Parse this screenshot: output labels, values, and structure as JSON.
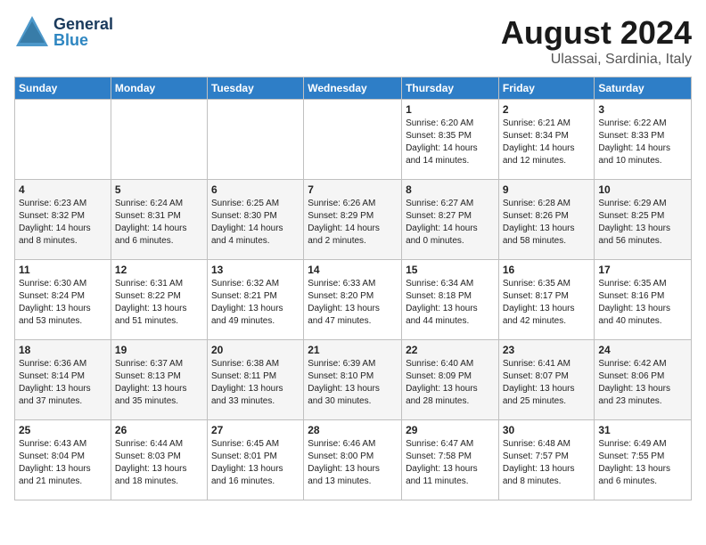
{
  "header": {
    "logo_general": "General",
    "logo_blue": "Blue",
    "month_year": "August 2024",
    "location": "Ulassai, Sardinia, Italy"
  },
  "calendar": {
    "days_of_week": [
      "Sunday",
      "Monday",
      "Tuesday",
      "Wednesday",
      "Thursday",
      "Friday",
      "Saturday"
    ],
    "weeks": [
      [
        {
          "day": "",
          "info": ""
        },
        {
          "day": "",
          "info": ""
        },
        {
          "day": "",
          "info": ""
        },
        {
          "day": "",
          "info": ""
        },
        {
          "day": "1",
          "info": "Sunrise: 6:20 AM\nSunset: 8:35 PM\nDaylight: 14 hours\nand 14 minutes."
        },
        {
          "day": "2",
          "info": "Sunrise: 6:21 AM\nSunset: 8:34 PM\nDaylight: 14 hours\nand 12 minutes."
        },
        {
          "day": "3",
          "info": "Sunrise: 6:22 AM\nSunset: 8:33 PM\nDaylight: 14 hours\nand 10 minutes."
        }
      ],
      [
        {
          "day": "4",
          "info": "Sunrise: 6:23 AM\nSunset: 8:32 PM\nDaylight: 14 hours\nand 8 minutes."
        },
        {
          "day": "5",
          "info": "Sunrise: 6:24 AM\nSunset: 8:31 PM\nDaylight: 14 hours\nand 6 minutes."
        },
        {
          "day": "6",
          "info": "Sunrise: 6:25 AM\nSunset: 8:30 PM\nDaylight: 14 hours\nand 4 minutes."
        },
        {
          "day": "7",
          "info": "Sunrise: 6:26 AM\nSunset: 8:29 PM\nDaylight: 14 hours\nand 2 minutes."
        },
        {
          "day": "8",
          "info": "Sunrise: 6:27 AM\nSunset: 8:27 PM\nDaylight: 14 hours\nand 0 minutes."
        },
        {
          "day": "9",
          "info": "Sunrise: 6:28 AM\nSunset: 8:26 PM\nDaylight: 13 hours\nand 58 minutes."
        },
        {
          "day": "10",
          "info": "Sunrise: 6:29 AM\nSunset: 8:25 PM\nDaylight: 13 hours\nand 56 minutes."
        }
      ],
      [
        {
          "day": "11",
          "info": "Sunrise: 6:30 AM\nSunset: 8:24 PM\nDaylight: 13 hours\nand 53 minutes."
        },
        {
          "day": "12",
          "info": "Sunrise: 6:31 AM\nSunset: 8:22 PM\nDaylight: 13 hours\nand 51 minutes."
        },
        {
          "day": "13",
          "info": "Sunrise: 6:32 AM\nSunset: 8:21 PM\nDaylight: 13 hours\nand 49 minutes."
        },
        {
          "day": "14",
          "info": "Sunrise: 6:33 AM\nSunset: 8:20 PM\nDaylight: 13 hours\nand 47 minutes."
        },
        {
          "day": "15",
          "info": "Sunrise: 6:34 AM\nSunset: 8:18 PM\nDaylight: 13 hours\nand 44 minutes."
        },
        {
          "day": "16",
          "info": "Sunrise: 6:35 AM\nSunset: 8:17 PM\nDaylight: 13 hours\nand 42 minutes."
        },
        {
          "day": "17",
          "info": "Sunrise: 6:35 AM\nSunset: 8:16 PM\nDaylight: 13 hours\nand 40 minutes."
        }
      ],
      [
        {
          "day": "18",
          "info": "Sunrise: 6:36 AM\nSunset: 8:14 PM\nDaylight: 13 hours\nand 37 minutes."
        },
        {
          "day": "19",
          "info": "Sunrise: 6:37 AM\nSunset: 8:13 PM\nDaylight: 13 hours\nand 35 minutes."
        },
        {
          "day": "20",
          "info": "Sunrise: 6:38 AM\nSunset: 8:11 PM\nDaylight: 13 hours\nand 33 minutes."
        },
        {
          "day": "21",
          "info": "Sunrise: 6:39 AM\nSunset: 8:10 PM\nDaylight: 13 hours\nand 30 minutes."
        },
        {
          "day": "22",
          "info": "Sunrise: 6:40 AM\nSunset: 8:09 PM\nDaylight: 13 hours\nand 28 minutes."
        },
        {
          "day": "23",
          "info": "Sunrise: 6:41 AM\nSunset: 8:07 PM\nDaylight: 13 hours\nand 25 minutes."
        },
        {
          "day": "24",
          "info": "Sunrise: 6:42 AM\nSunset: 8:06 PM\nDaylight: 13 hours\nand 23 minutes."
        }
      ],
      [
        {
          "day": "25",
          "info": "Sunrise: 6:43 AM\nSunset: 8:04 PM\nDaylight: 13 hours\nand 21 minutes."
        },
        {
          "day": "26",
          "info": "Sunrise: 6:44 AM\nSunset: 8:03 PM\nDaylight: 13 hours\nand 18 minutes."
        },
        {
          "day": "27",
          "info": "Sunrise: 6:45 AM\nSunset: 8:01 PM\nDaylight: 13 hours\nand 16 minutes."
        },
        {
          "day": "28",
          "info": "Sunrise: 6:46 AM\nSunset: 8:00 PM\nDaylight: 13 hours\nand 13 minutes."
        },
        {
          "day": "29",
          "info": "Sunrise: 6:47 AM\nSunset: 7:58 PM\nDaylight: 13 hours\nand 11 minutes."
        },
        {
          "day": "30",
          "info": "Sunrise: 6:48 AM\nSunset: 7:57 PM\nDaylight: 13 hours\nand 8 minutes."
        },
        {
          "day": "31",
          "info": "Sunrise: 6:49 AM\nSunset: 7:55 PM\nDaylight: 13 hours\nand 6 minutes."
        }
      ]
    ]
  }
}
